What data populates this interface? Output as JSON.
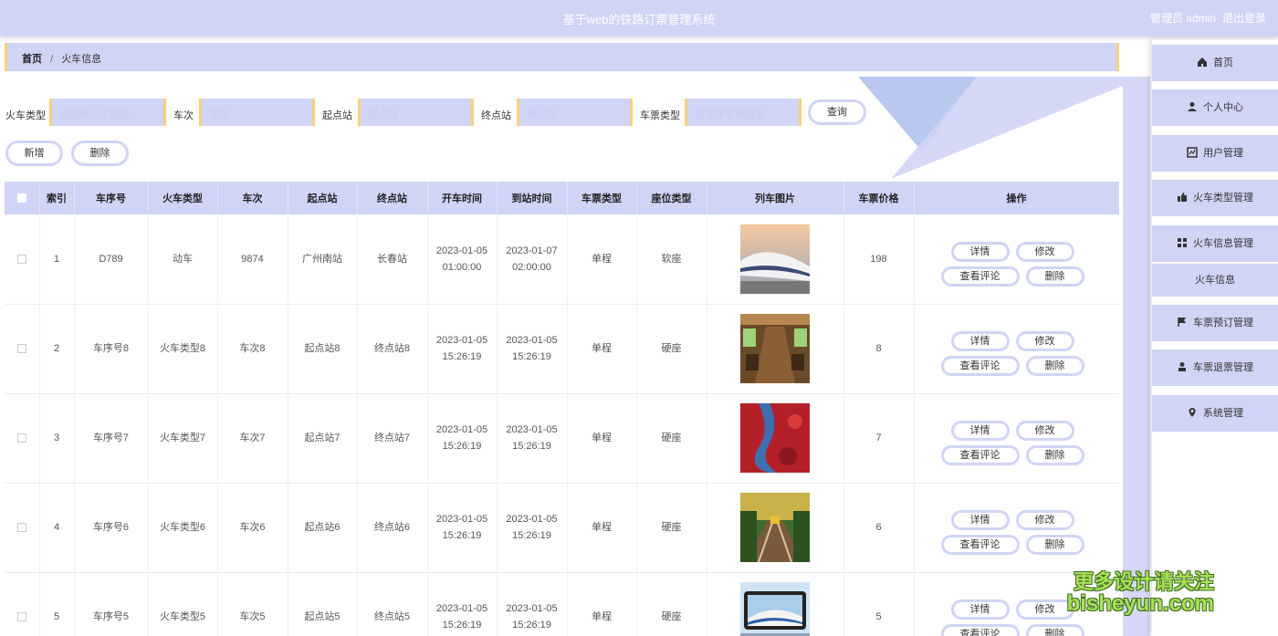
{
  "header": {
    "title": "基于web的铁路订票管理系统",
    "user": "管理员 admin",
    "logout": "退出登录"
  },
  "breadcrumb": {
    "home": "首页",
    "separator": "/",
    "current": "火车信息"
  },
  "search": {
    "train_type_label": "火车类型",
    "train_type_placeholder": "请选择火车类型",
    "train_no_label": "车次",
    "train_no_placeholder": "车次",
    "start_label": "起点站",
    "start_placeholder": "起点站",
    "end_label": "终点站",
    "end_placeholder": "终点站",
    "ticket_type_label": "车票类型",
    "ticket_type_placeholder": "请选择车票类型",
    "query_button": "查询"
  },
  "actions": {
    "add": "新增",
    "delete": "删除"
  },
  "table": {
    "columns": [
      "索引",
      "车序号",
      "火车类型",
      "车次",
      "起点站",
      "终点站",
      "开车时间",
      "到站时间",
      "车票类型",
      "座位类型",
      "列车图片",
      "车票价格",
      "操作"
    ],
    "row_buttons": {
      "detail": "详情",
      "edit": "修改",
      "comments": "查看评论",
      "delete": "删除"
    },
    "rows": [
      {
        "index": "1",
        "seq": "D789",
        "train_type": "动车",
        "train_no": "9874",
        "start": "广州南站",
        "end": "长春站",
        "depart_date": "2023-01-05",
        "depart_time": "01:00:00",
        "arrive_date": "2023-01-07",
        "arrive_time": "02:00:00",
        "ticket_type": "单程",
        "seat_type": "软座",
        "image": "bullet-train-photo",
        "price": "198"
      },
      {
        "index": "2",
        "seq": "车序号8",
        "train_type": "火车类型8",
        "train_no": "车次8",
        "start": "起点站8",
        "end": "终点站8",
        "depart_date": "2023-01-05",
        "depart_time": "15:26:19",
        "arrive_date": "2023-01-05",
        "arrive_time": "15:26:19",
        "ticket_type": "单程",
        "seat_type": "硬座",
        "image": "train-interior-photo",
        "price": "8"
      },
      {
        "index": "3",
        "seq": "车序号7",
        "train_type": "火车类型7",
        "train_no": "车次7",
        "start": "起点站7",
        "end": "终点站7",
        "depart_date": "2023-01-05",
        "depart_time": "15:26:19",
        "arrive_date": "2023-01-05",
        "arrive_time": "15:26:19",
        "ticket_type": "单程",
        "seat_type": "硬座",
        "image": "red-landscape-photo",
        "price": "7"
      },
      {
        "index": "4",
        "seq": "车序号6",
        "train_type": "火车类型6",
        "train_no": "车次6",
        "start": "起点站6",
        "end": "终点站6",
        "depart_date": "2023-01-05",
        "depart_time": "15:26:19",
        "arrive_date": "2023-01-05",
        "arrive_time": "15:26:19",
        "ticket_type": "单程",
        "seat_type": "硬座",
        "image": "forest-railway-photo",
        "price": "6"
      },
      {
        "index": "5",
        "seq": "车序号5",
        "train_type": "火车类型5",
        "train_no": "车次5",
        "start": "起点站5",
        "end": "终点站5",
        "depart_date": "2023-01-05",
        "depart_time": "15:26:19",
        "arrive_date": "2023-01-05",
        "arrive_time": "15:26:19",
        "ticket_type": "单程",
        "seat_type": "硬座",
        "image": "train-station-photo",
        "price": "5"
      }
    ]
  },
  "sidebar": {
    "items": [
      {
        "label": "首页",
        "icon": "home-icon"
      },
      {
        "label": "个人中心",
        "icon": "person-icon"
      },
      {
        "label": "用户管理",
        "icon": "chart-icon"
      },
      {
        "label": "火车类型管理",
        "icon": "thumb-icon"
      },
      {
        "label": "火车信息管理",
        "icon": "grid-icon"
      },
      {
        "label": "火车信息",
        "icon": ""
      },
      {
        "label": "车票预订管理",
        "icon": "flag-icon"
      },
      {
        "label": "车票退票管理",
        "icon": "user-icon"
      },
      {
        "label": "系统管理",
        "icon": "location-icon"
      }
    ]
  },
  "watermark": {
    "line1": "更多设计请关注",
    "line2": "bisheyun.com"
  },
  "colors": {
    "primary": "#d0d4f5",
    "accent": "#f7d07a",
    "watermark": "#a8e05a"
  }
}
